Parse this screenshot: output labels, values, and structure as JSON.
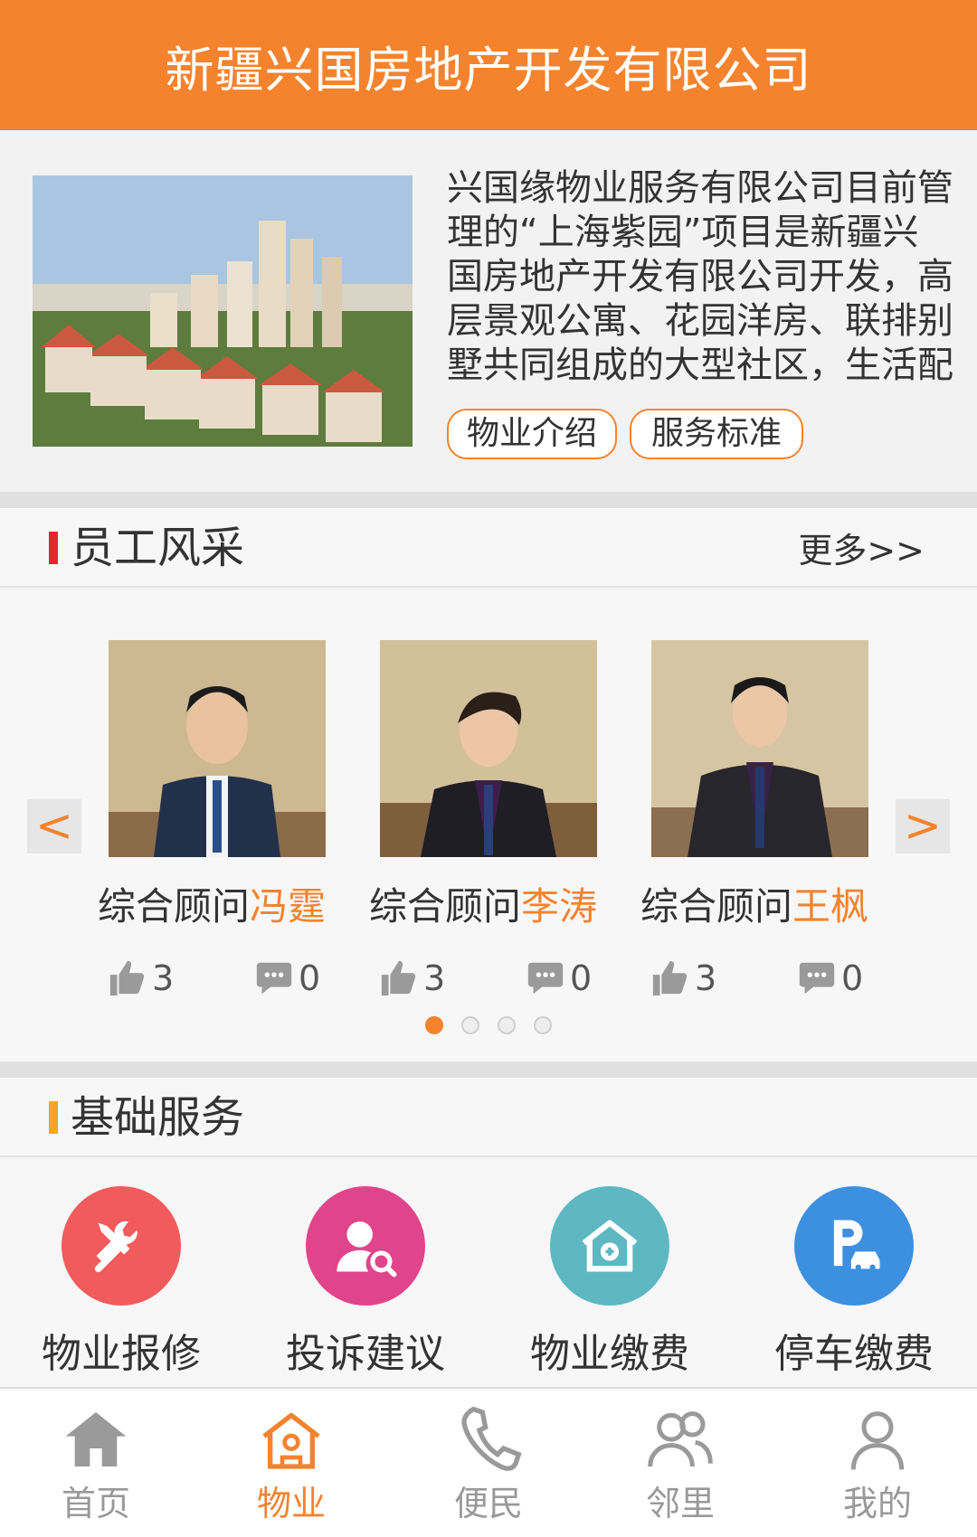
{
  "header": {
    "title": "新疆兴国房地产开发有限公司"
  },
  "intro": {
    "description": "兴国缘物业服务有限公司目前管理的“上海紫园”项目是新疆兴国房地产开发有限公司开发，高层景观公寓、花园洋房、联排别墅共同组成的大型社区，生活配套设施完善",
    "buttons": [
      "物业介绍",
      "服务标准"
    ]
  },
  "staff_section": {
    "title": "员工风采",
    "more": "更多>>",
    "prev_arrow": "<",
    "next_arrow": ">",
    "members": [
      {
        "role": "综合顾问",
        "name": "冯霆",
        "likes": "3",
        "comments": "0"
      },
      {
        "role": "综合顾问",
        "name": "李涛",
        "likes": "3",
        "comments": "0"
      },
      {
        "role": "综合顾问",
        "name": "王枫",
        "likes": "3",
        "comments": "0"
      }
    ],
    "pagination": {
      "total": 4,
      "active": 1
    }
  },
  "services_section": {
    "title": "基础服务",
    "items": [
      {
        "label": "物业报修",
        "icon": "wrench-screwdriver-icon",
        "color": "#f15b5b"
      },
      {
        "label": "投诉建议",
        "icon": "person-search-icon",
        "color": "#e0458b"
      },
      {
        "label": "物业缴费",
        "icon": "house-payment-icon",
        "color": "#5db8c2"
      },
      {
        "label": "停车缴费",
        "icon": "parking-car-icon",
        "color": "#3d8fe0"
      }
    ]
  },
  "tabbar": {
    "items": [
      {
        "label": "首页",
        "icon": "home-icon"
      },
      {
        "label": "物业",
        "icon": "property-icon"
      },
      {
        "label": "便民",
        "icon": "phone-icon"
      },
      {
        "label": "邻里",
        "icon": "neighbors-icon"
      },
      {
        "label": "我的",
        "icon": "profile-icon"
      }
    ],
    "active": "物业"
  },
  "colors": {
    "accent": "#f5832d",
    "staff_bar": "#e8262a",
    "service_bar": "#f5a623"
  }
}
